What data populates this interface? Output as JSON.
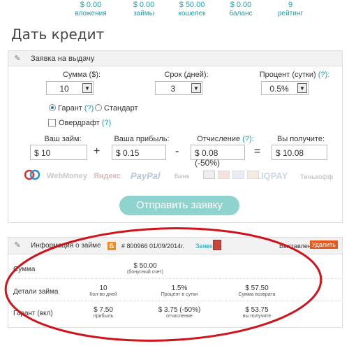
{
  "stats": [
    {
      "value": "$ 0.00",
      "label": "вложения"
    },
    {
      "value": "$ 0.00",
      "label": "займы"
    },
    {
      "value": "$ 50.00",
      "label": "кошелек"
    },
    {
      "value": "$ 0.00",
      "label": "баланс"
    },
    {
      "value": "9",
      "label": "рейтинг"
    }
  ],
  "title": "Дать кредит",
  "form": {
    "header": "Заявка на выдачу",
    "amount": {
      "label": "Сумма ($):",
      "value": "10"
    },
    "term": {
      "label": "Срок (дней):",
      "value": "3"
    },
    "rate": {
      "label": "Процент (сутки)",
      "help": "(?):",
      "value": "0.5%"
    },
    "guarantee": {
      "label": "Гарант",
      "help": "(?)",
      "selected": true
    },
    "standard": {
      "label": "Стандарт",
      "selected": false
    },
    "overdraft": {
      "label": "Овердрафт",
      "help": "(?)",
      "checked": false
    },
    "loan": {
      "label": "Ваш займ:",
      "value": "$ 10"
    },
    "profit": {
      "label": "Ваша прибыль:",
      "value": "$ 0.15"
    },
    "fee": {
      "label": "Отчисление",
      "help": "(?):",
      "value": "$ 0.08 (-50%)"
    },
    "receive": {
      "label": "Вы получите:",
      "value": "$ 10.08"
    },
    "ops": [
      "+",
      "-",
      "="
    ],
    "payments": [
      "WebMoney",
      "Яндекс",
      "PayPal",
      "Банк",
      "LIQPAY",
      "Тинькофф"
    ],
    "submit": "Отправить заявку"
  },
  "info": {
    "header": "Информация о займе",
    "badge": "Б",
    "loan_ref": "# 800966 01/09/2014г.",
    "link": "Заявка",
    "status": "Выставлена",
    "delete": "Удалить",
    "sum_label": "Сумма",
    "sum_value": "$ 50.00",
    "sum_sub": "(бонусный счет)",
    "details_label": "Детали займа",
    "details": [
      {
        "value": "10",
        "sub": "Кол-во дней"
      },
      {
        "value": "1.5%",
        "sub": "Процент в сутки"
      },
      {
        "value": "$ 57.50",
        "sub": "Сумма возврата"
      }
    ],
    "guarantee_label": "Гарант (вкл)",
    "guarantee": [
      {
        "value": "$ 7.50",
        "sub": "прибыль"
      },
      {
        "value": "$ 3.75 (-50%)",
        "sub": "отчисление"
      },
      {
        "value": "$ 53.75",
        "sub": "вы получите"
      }
    ]
  },
  "colors": {
    "accent": "#1a9fb3",
    "button": "#8fd3cf",
    "delete": "#e55a1c",
    "badge": "#f58b1f",
    "annotation": "#d0121b"
  }
}
